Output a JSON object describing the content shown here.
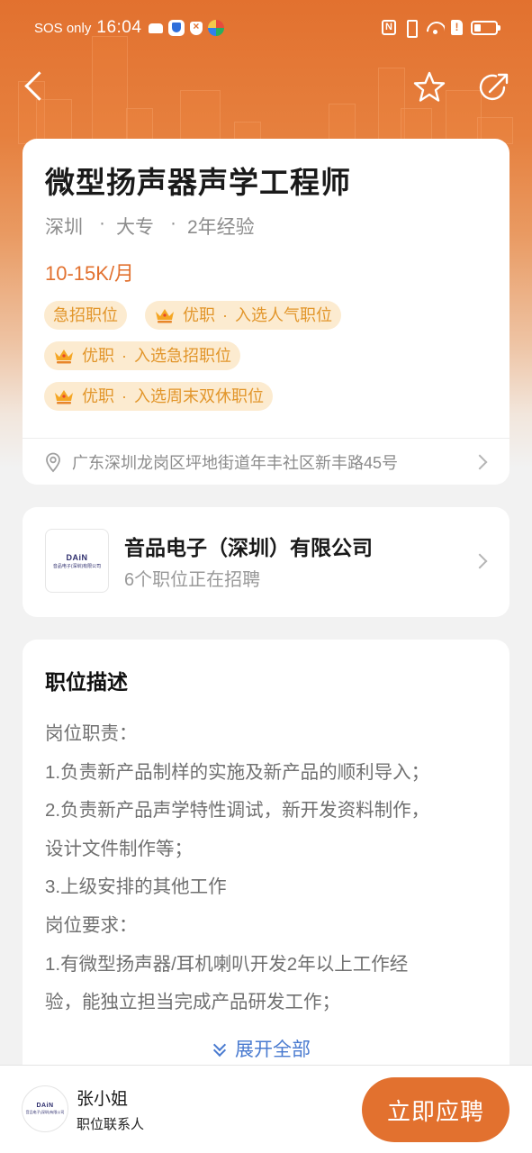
{
  "status_bar": {
    "carrier": "SOS only",
    "time": "16:04",
    "left_icons": [
      "game-icon",
      "shield-app-icon",
      "security-icon",
      "browser-icon"
    ],
    "right_icons": [
      "nfc-icon",
      "vibrate-icon",
      "wifi-6-icon",
      "sim-alert-icon",
      "battery-low-icon"
    ],
    "sim_alert": "!",
    "nfc": "N"
  },
  "nav": {
    "back_icon": "chevron-left-icon",
    "favorite_icon": "star-outline-icon",
    "share_icon": "share-icon"
  },
  "job": {
    "title": "微型扬声器声学工程师",
    "meta": [
      "深圳",
      "大专",
      "2年经验"
    ],
    "meta_separator": "·",
    "salary": "10-15K/月",
    "tags": [
      {
        "label": "急招职位",
        "crown": false
      },
      {
        "label": "优职",
        "detail": "入选人气职位",
        "crown": true
      },
      {
        "label": "优职",
        "detail": "入选急招职位",
        "crown": true
      },
      {
        "label": "优职",
        "detail": "入选周末双休职位",
        "crown": true
      }
    ],
    "tag_separator": "·",
    "address": "广东深圳龙岗区坪地街道年丰社区新丰路45号"
  },
  "company": {
    "logo_text": "DAiN",
    "logo_subtext": "音品电子(深圳)有限公司",
    "name": "音品电子（深圳）有限公司",
    "jobs_hiring": "6个职位正在招聘"
  },
  "description": {
    "title": "职位描述",
    "lines": [
      "岗位职责：",
      "1.负责新产品制样的实施及新产品的顺利导入；",
      "2.负责新产品声学特性调试，新开发资料制作，",
      "设计文件制作等；",
      "3.上级安排的其他工作",
      "岗位要求：",
      "1.有微型扬声器/耳机喇叭开发2年以上工作经",
      "验，能独立担当完成产品研发工作；"
    ],
    "expand_label": "展开全部"
  },
  "contact": {
    "name": "张小姐",
    "role": "职位联系人",
    "apply_label": "立即应聘"
  },
  "colors": {
    "brand_orange": "#E2712F",
    "tag_bg": "#FCEBD0",
    "tag_text": "#E2962B",
    "link_blue": "#4A7BD0"
  }
}
